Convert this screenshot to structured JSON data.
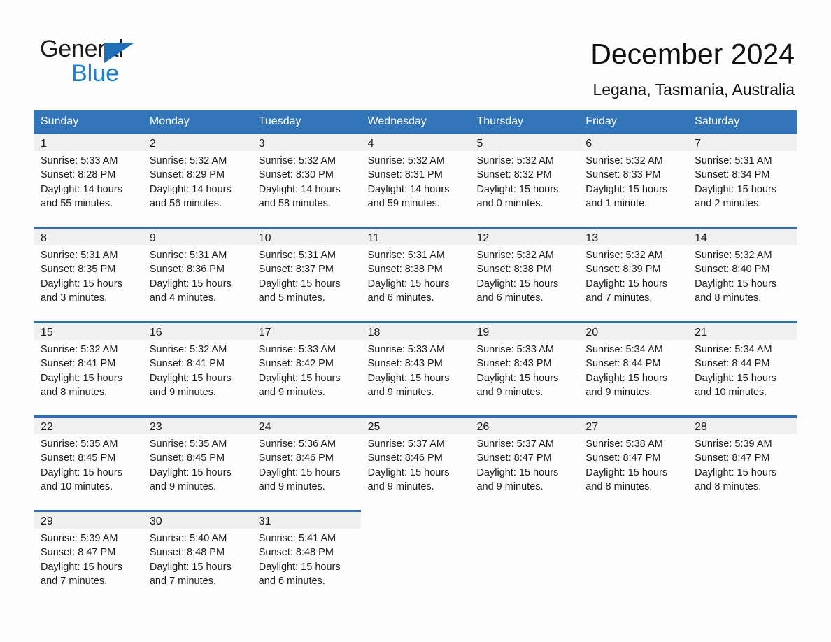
{
  "brand": {
    "name_part1": "General",
    "name_part2": "Blue",
    "accent_color": "#1c7fd6",
    "triangle_color": "#1c6fb8"
  },
  "header": {
    "title": "December 2024",
    "location": "Legana, Tasmania, Australia",
    "header_bg": "#3275b8",
    "row_divider_color": "#2f6eb0",
    "day_band_bg": "#f0f0f0"
  },
  "weekdays": [
    "Sunday",
    "Monday",
    "Tuesday",
    "Wednesday",
    "Thursday",
    "Friday",
    "Saturday"
  ],
  "weeks": [
    [
      {
        "day": "1",
        "sunrise": "Sunrise: 5:33 AM",
        "sunset": "Sunset: 8:28 PM",
        "daylight": "Daylight: 14 hours and 55 minutes."
      },
      {
        "day": "2",
        "sunrise": "Sunrise: 5:32 AM",
        "sunset": "Sunset: 8:29 PM",
        "daylight": "Daylight: 14 hours and 56 minutes."
      },
      {
        "day": "3",
        "sunrise": "Sunrise: 5:32 AM",
        "sunset": "Sunset: 8:30 PM",
        "daylight": "Daylight: 14 hours and 58 minutes."
      },
      {
        "day": "4",
        "sunrise": "Sunrise: 5:32 AM",
        "sunset": "Sunset: 8:31 PM",
        "daylight": "Daylight: 14 hours and 59 minutes."
      },
      {
        "day": "5",
        "sunrise": "Sunrise: 5:32 AM",
        "sunset": "Sunset: 8:32 PM",
        "daylight": "Daylight: 15 hours and 0 minutes."
      },
      {
        "day": "6",
        "sunrise": "Sunrise: 5:32 AM",
        "sunset": "Sunset: 8:33 PM",
        "daylight": "Daylight: 15 hours and 1 minute."
      },
      {
        "day": "7",
        "sunrise": "Sunrise: 5:31 AM",
        "sunset": "Sunset: 8:34 PM",
        "daylight": "Daylight: 15 hours and 2 minutes."
      }
    ],
    [
      {
        "day": "8",
        "sunrise": "Sunrise: 5:31 AM",
        "sunset": "Sunset: 8:35 PM",
        "daylight": "Daylight: 15 hours and 3 minutes."
      },
      {
        "day": "9",
        "sunrise": "Sunrise: 5:31 AM",
        "sunset": "Sunset: 8:36 PM",
        "daylight": "Daylight: 15 hours and 4 minutes."
      },
      {
        "day": "10",
        "sunrise": "Sunrise: 5:31 AM",
        "sunset": "Sunset: 8:37 PM",
        "daylight": "Daylight: 15 hours and 5 minutes."
      },
      {
        "day": "11",
        "sunrise": "Sunrise: 5:31 AM",
        "sunset": "Sunset: 8:38 PM",
        "daylight": "Daylight: 15 hours and 6 minutes."
      },
      {
        "day": "12",
        "sunrise": "Sunrise: 5:32 AM",
        "sunset": "Sunset: 8:38 PM",
        "daylight": "Daylight: 15 hours and 6 minutes."
      },
      {
        "day": "13",
        "sunrise": "Sunrise: 5:32 AM",
        "sunset": "Sunset: 8:39 PM",
        "daylight": "Daylight: 15 hours and 7 minutes."
      },
      {
        "day": "14",
        "sunrise": "Sunrise: 5:32 AM",
        "sunset": "Sunset: 8:40 PM",
        "daylight": "Daylight: 15 hours and 8 minutes."
      }
    ],
    [
      {
        "day": "15",
        "sunrise": "Sunrise: 5:32 AM",
        "sunset": "Sunset: 8:41 PM",
        "daylight": "Daylight: 15 hours and 8 minutes."
      },
      {
        "day": "16",
        "sunrise": "Sunrise: 5:32 AM",
        "sunset": "Sunset: 8:41 PM",
        "daylight": "Daylight: 15 hours and 9 minutes."
      },
      {
        "day": "17",
        "sunrise": "Sunrise: 5:33 AM",
        "sunset": "Sunset: 8:42 PM",
        "daylight": "Daylight: 15 hours and 9 minutes."
      },
      {
        "day": "18",
        "sunrise": "Sunrise: 5:33 AM",
        "sunset": "Sunset: 8:43 PM",
        "daylight": "Daylight: 15 hours and 9 minutes."
      },
      {
        "day": "19",
        "sunrise": "Sunrise: 5:33 AM",
        "sunset": "Sunset: 8:43 PM",
        "daylight": "Daylight: 15 hours and 9 minutes."
      },
      {
        "day": "20",
        "sunrise": "Sunrise: 5:34 AM",
        "sunset": "Sunset: 8:44 PM",
        "daylight": "Daylight: 15 hours and 9 minutes."
      },
      {
        "day": "21",
        "sunrise": "Sunrise: 5:34 AM",
        "sunset": "Sunset: 8:44 PM",
        "daylight": "Daylight: 15 hours and 10 minutes."
      }
    ],
    [
      {
        "day": "22",
        "sunrise": "Sunrise: 5:35 AM",
        "sunset": "Sunset: 8:45 PM",
        "daylight": "Daylight: 15 hours and 10 minutes."
      },
      {
        "day": "23",
        "sunrise": "Sunrise: 5:35 AM",
        "sunset": "Sunset: 8:45 PM",
        "daylight": "Daylight: 15 hours and 9 minutes."
      },
      {
        "day": "24",
        "sunrise": "Sunrise: 5:36 AM",
        "sunset": "Sunset: 8:46 PM",
        "daylight": "Daylight: 15 hours and 9 minutes."
      },
      {
        "day": "25",
        "sunrise": "Sunrise: 5:37 AM",
        "sunset": "Sunset: 8:46 PM",
        "daylight": "Daylight: 15 hours and 9 minutes."
      },
      {
        "day": "26",
        "sunrise": "Sunrise: 5:37 AM",
        "sunset": "Sunset: 8:47 PM",
        "daylight": "Daylight: 15 hours and 9 minutes."
      },
      {
        "day": "27",
        "sunrise": "Sunrise: 5:38 AM",
        "sunset": "Sunset: 8:47 PM",
        "daylight": "Daylight: 15 hours and 8 minutes."
      },
      {
        "day": "28",
        "sunrise": "Sunrise: 5:39 AM",
        "sunset": "Sunset: 8:47 PM",
        "daylight": "Daylight: 15 hours and 8 minutes."
      }
    ],
    [
      {
        "day": "29",
        "sunrise": "Sunrise: 5:39 AM",
        "sunset": "Sunset: 8:47 PM",
        "daylight": "Daylight: 15 hours and 7 minutes."
      },
      {
        "day": "30",
        "sunrise": "Sunrise: 5:40 AM",
        "sunset": "Sunset: 8:48 PM",
        "daylight": "Daylight: 15 hours and 7 minutes."
      },
      {
        "day": "31",
        "sunrise": "Sunrise: 5:41 AM",
        "sunset": "Sunset: 8:48 PM",
        "daylight": "Daylight: 15 hours and 6 minutes."
      },
      {
        "day": "",
        "sunrise": "",
        "sunset": "",
        "daylight": ""
      },
      {
        "day": "",
        "sunrise": "",
        "sunset": "",
        "daylight": ""
      },
      {
        "day": "",
        "sunrise": "",
        "sunset": "",
        "daylight": ""
      },
      {
        "day": "",
        "sunrise": "",
        "sunset": "",
        "daylight": ""
      }
    ]
  ]
}
